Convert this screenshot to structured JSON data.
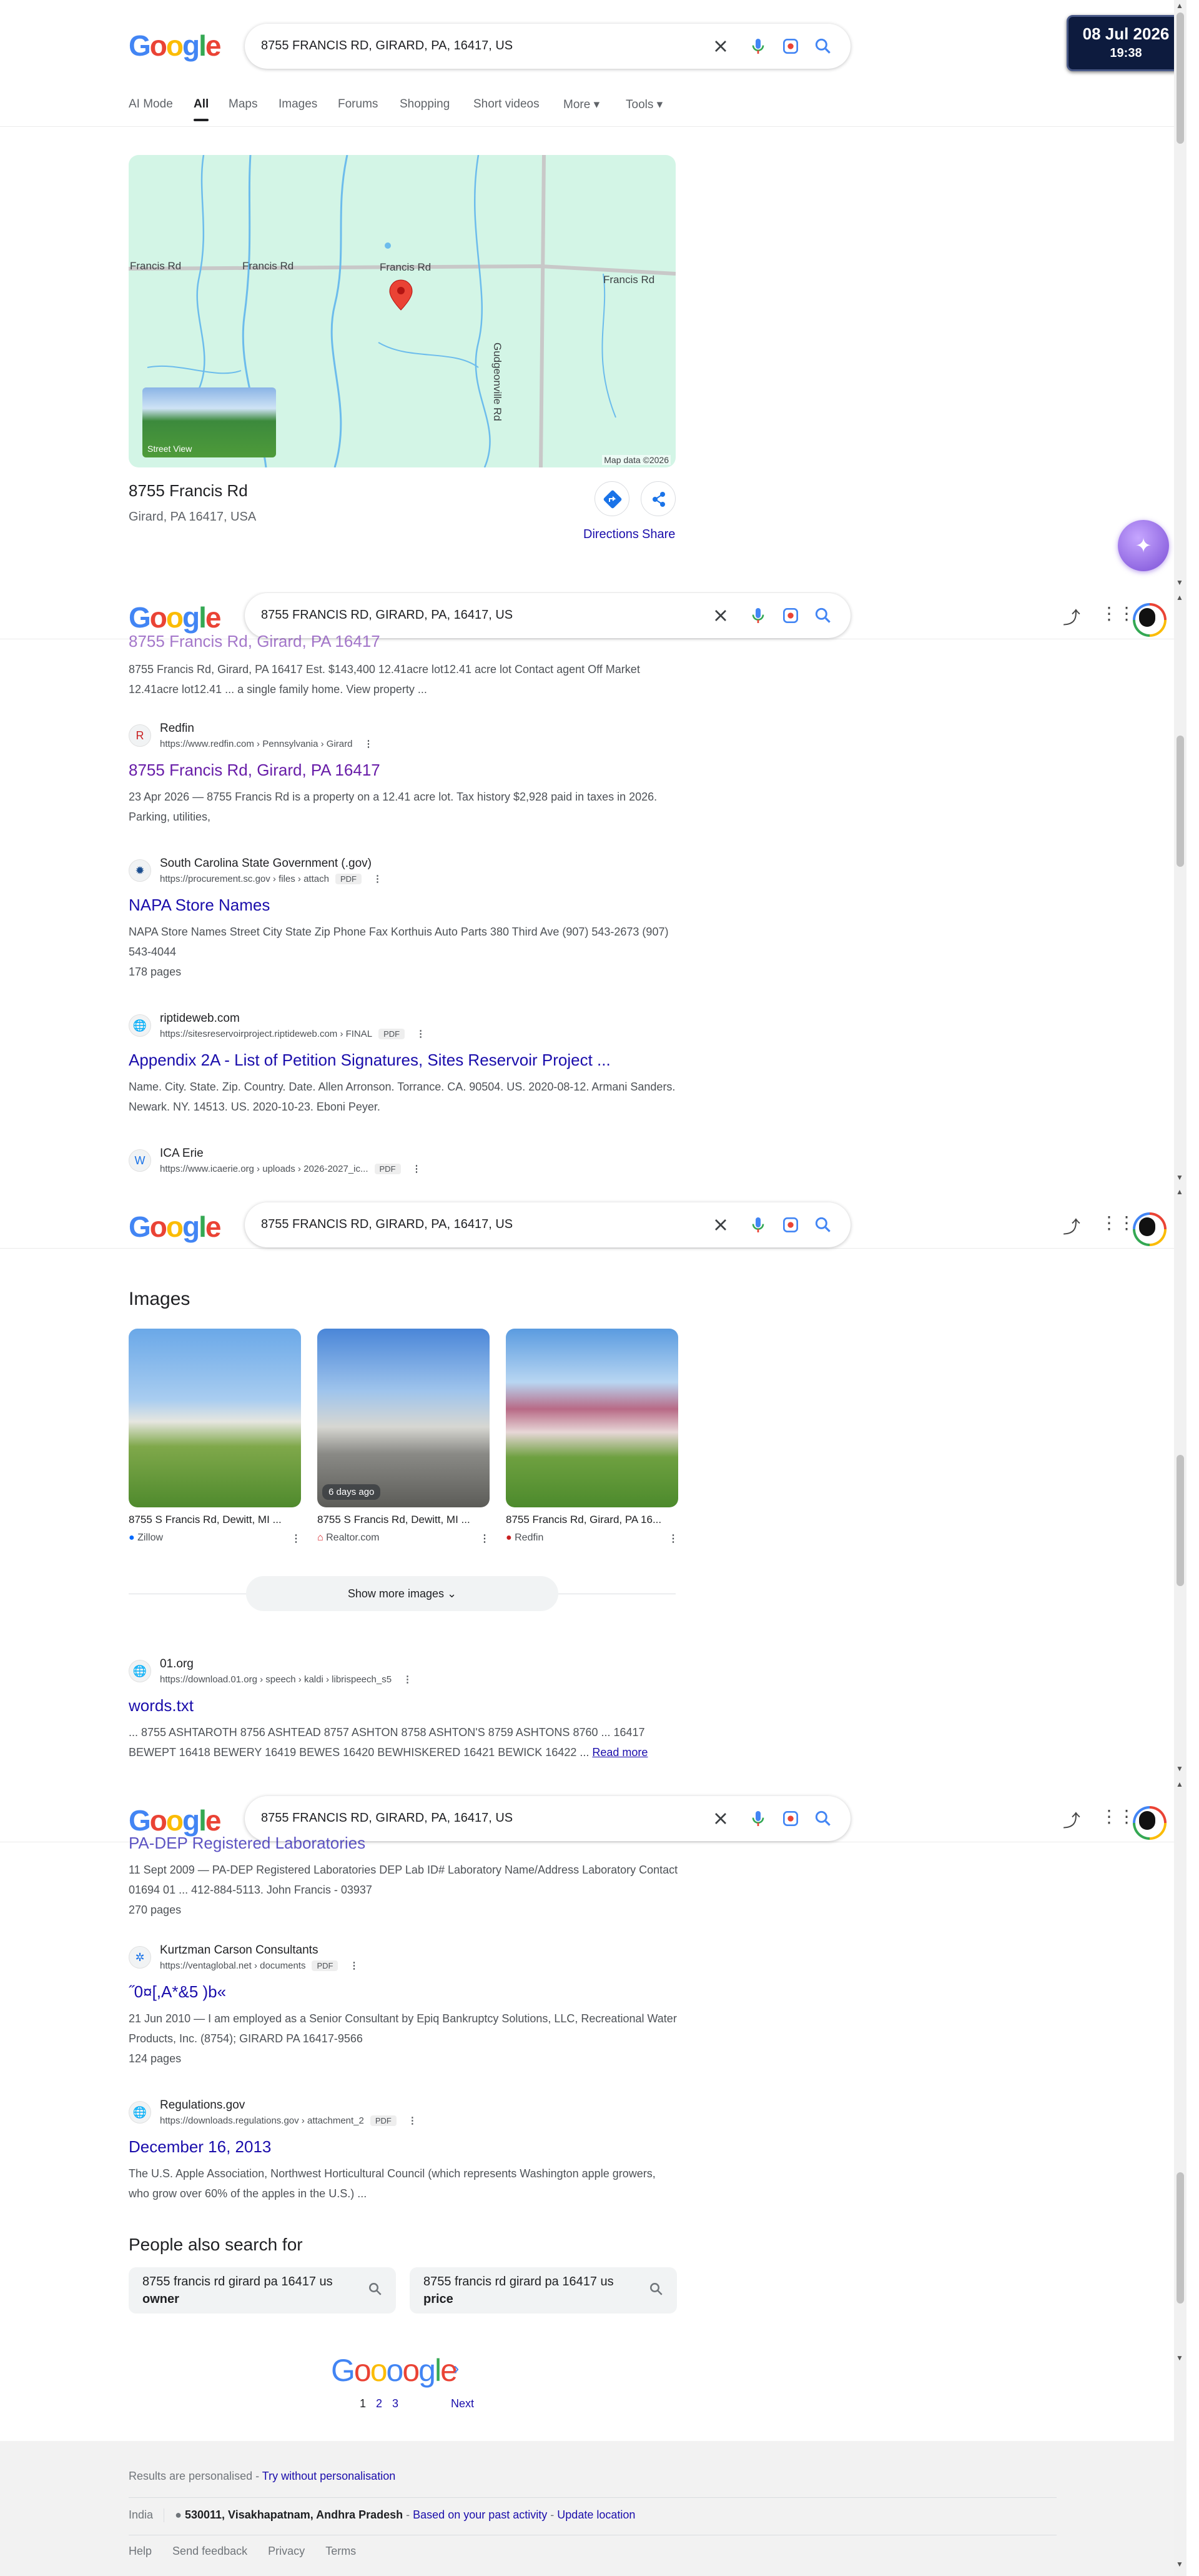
{
  "search": {
    "query": "8755 FRANCIS RD, GIRARD, PA, 16417, US"
  },
  "datetime": {
    "date": "08 Jul 2026",
    "time": "19:38"
  },
  "tabs": [
    "AI Mode",
    "All",
    "Maps",
    "Images",
    "Forums",
    "Shopping",
    "Short videos",
    "More",
    "Tools"
  ],
  "map": {
    "labels": [
      "Francis Rd",
      "Francis Rd",
      "Francis Rd",
      "Francis Rd",
      "Gudgeonville Rd"
    ],
    "street_view": "Street View",
    "data": "Map data ©2026"
  },
  "place": {
    "title": "8755 Francis Rd",
    "address": "Girard, PA 16417, USA",
    "directions": "Directions",
    "share": "Share"
  },
  "panel2": {
    "cut_title": "8755 Francis Rd, Girard, PA 16417",
    "cut_snippet": "8755 Francis Rd, Girard, PA 16417 Est. $143,400 12.41acre lot12.41 acre lot Contact agent Off Market 12.41acre lot12.41 ... a single family home. View property ...",
    "results": [
      {
        "site": "Redfin",
        "url": "https://www.redfin.com › Pennsylvania › Girard",
        "pdf": "",
        "title": "8755 Francis Rd, Girard, PA 16417",
        "snippet": "23 Apr 2026 — 8755 Francis Rd is a property on a 12.41 acre lot. Tax history $2,928 paid in taxes in 2026. Parking, utilities,",
        "pages": ""
      },
      {
        "site": "South Carolina State Government (.gov)",
        "url": "https://procurement.sc.gov › files › attach",
        "pdf": "PDF",
        "title": "NAPA Store Names",
        "snippet": "NAPA Store Names Street City State Zip Phone Fax Korthuis Auto Parts 380 Third Ave (907) 543-2673 (907) 543-4044",
        "pages": "178 pages"
      },
      {
        "site": "riptideweb.com",
        "url": "https://sitesreservoirproject.riptideweb.com › FINAL",
        "pdf": "PDF",
        "title": "Appendix 2A - List of Petition Signatures, Sites Reservoir Project ...",
        "snippet": "Name. City. State. Zip. Country. Date. Allen Arronson. Torrance. CA. 90504. US. 2020-08-12. Armani Sanders. Newark. NY. 14513. US. 2020-10-23. Eboni Peyer.",
        "pages": ""
      },
      {
        "site": "ICA Erie",
        "url": "https://www.icaerie.org › uploads › 2026-2027_ic...",
        "pdf": "PDF",
        "title": "",
        "snippet": "",
        "pages": ""
      }
    ]
  },
  "images": {
    "heading": "Images",
    "cards": [
      {
        "caption": "8755 S Francis Rd, Dewitt, MI ...",
        "source": "Zillow",
        "badge": ""
      },
      {
        "caption": "8755 S Francis Rd, Dewitt, MI ...",
        "source": "Realtor.com",
        "badge": "6 days ago"
      },
      {
        "caption": "8755 Francis Rd, Girard, PA 16...",
        "source": "Redfin",
        "badge": ""
      }
    ],
    "show_more": "Show more images"
  },
  "words_result": {
    "site": "01.org",
    "url": "https://download.01.org › speech › kaldi › librispeech_s5",
    "title": "words.txt",
    "snippet": "... 8755 ASHTAROTH 8756 ASHTEAD 8757 ASHTON 8758 ASHTON'S 8759 ASHTONS 8760 ... 16417 BEWEPT 16418 BEWERY 16419 BEWES 16420 BEWHISKERED 16421 BEWICK 16422 ...",
    "read_more": "Read more"
  },
  "panel4": {
    "cut_title": "PA-DEP Registered Laboratories",
    "cut_snippet": "11 Sept 2009 — PA-DEP Registered Laboratories DEP Lab ID# Laboratory Name/Address Laboratory Contact 01694 01 ... 412-884-5113. John Francis - 03937",
    "cut_pages": "270 pages",
    "results": [
      {
        "site": "Kurtzman Carson Consultants",
        "url": "https://ventaglobal.net › documents",
        "pdf": "PDF",
        "title": "˝0¤[,A*&5 )b«",
        "snippet": "21 Jun 2010 — I am employed as a Senior Consultant by Epiq Bankruptcy Solutions, LLC, Recreational Water Products, Inc. (8754); GIRARD PA 16417-9566",
        "pages": "124 pages"
      },
      {
        "site": "Regulations.gov",
        "url": "https://downloads.regulations.gov › attachment_2",
        "pdf": "PDF",
        "title": "December 16, 2013",
        "snippet": "The U.S. Apple Association, Northwest Horticultural Council (which represents Washington apple growers, who grow over 60% of the apples in the U.S.) ...",
        "pages": ""
      }
    ],
    "people_also": "People also search for",
    "chips": [
      {
        "a": "8755 francis rd girard pa 16417 us",
        "b": "owner"
      },
      {
        "a": "8755 francis rd girard pa 16417 us",
        "b": "price"
      }
    ]
  },
  "pagination": {
    "logo": "Goooogle",
    "pages": [
      "1",
      "2",
      "3"
    ],
    "next": "Next"
  },
  "footer": {
    "personalised": "Results are personalised - ",
    "try_without": "Try without personalisation",
    "country": "India",
    "location": "530011, Visakhapatnam, Andhra Pradesh",
    "loc_sep": " - ",
    "based_on": "Based on your past activity",
    "update": "Update location",
    "links": [
      "Help",
      "Send feedback",
      "Privacy",
      "Terms"
    ]
  },
  "colors": {
    "link": "#1a0dab",
    "visited": "#681da8",
    "blue": "#4285f4",
    "red": "#ea4335",
    "yellow": "#fbbc05",
    "green": "#34a853"
  }
}
